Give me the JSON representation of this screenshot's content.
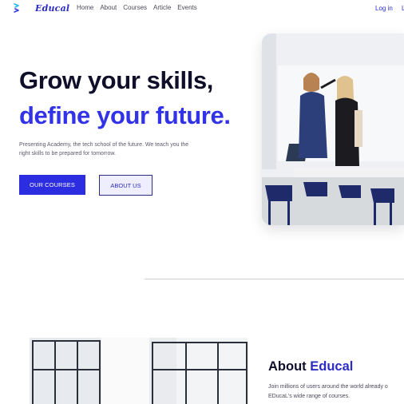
{
  "brand": {
    "name": "Educal",
    "logo_icon": "logo-mark-icon",
    "accent_color": "#2c2ce0"
  },
  "nav": {
    "links": [
      "Home",
      "About",
      "Courses",
      "Article",
      "Events"
    ],
    "login": "Log in",
    "signup_partial": "L"
  },
  "hero": {
    "title_line1": "Grow your skills,",
    "title_line2": "define your future.",
    "description_line1": "Presenting Academy, the tech school of the future. We teach you the",
    "description_line2": "right skills to be prepared for tomorrow.",
    "primary_button": "OUR COURSES",
    "secondary_button": "ABOUT US"
  },
  "about": {
    "title_prefix": "About ",
    "title_accent": "Educal",
    "description_line1": "Join millions of users around the world already o",
    "description_line2": "EDucaL's wide range of courses."
  }
}
